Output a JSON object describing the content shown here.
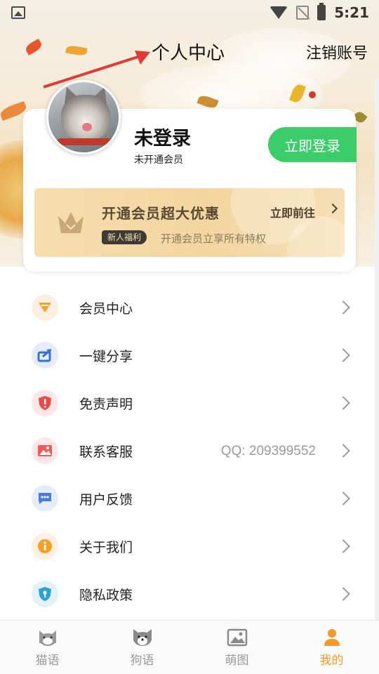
{
  "status_bar": {
    "time": "5:21"
  },
  "header": {
    "title": "个人中心",
    "logout_label": "注销账号"
  },
  "profile": {
    "username": "未登录",
    "member_status": "未开通会员",
    "login_button": "立即登录"
  },
  "vip_banner": {
    "title": "开通会员超大优惠",
    "go_label": "立即前往",
    "tag": "新人福利",
    "subtitle": "开通会员立享所有特权"
  },
  "menu": {
    "items": [
      {
        "label": "会员中心",
        "icon": "diamond-icon",
        "color": "#f4a02d",
        "bg": "#fdf0e0"
      },
      {
        "label": "一键分享",
        "icon": "share-icon",
        "color": "#3a6fd8",
        "bg": "#e4ecfa"
      },
      {
        "label": "免责声明",
        "icon": "shield-alert-icon",
        "color": "#e84a4a",
        "bg": "#fde6e6"
      },
      {
        "label": "联系客服",
        "icon": "image-icon",
        "color": "#ef5a5a",
        "bg": "#fde6e6",
        "extra": "QQ: 209399552"
      },
      {
        "label": "用户反馈",
        "icon": "chat-icon",
        "color": "#4a7be0",
        "bg": "#e5ecfb"
      },
      {
        "label": "关于我们",
        "icon": "info-icon",
        "color": "#f3a12a",
        "bg": "#fdf0de"
      },
      {
        "label": "隐私政策",
        "icon": "shield-lock-icon",
        "color": "#2f9fd8",
        "bg": "#e1f2fb"
      }
    ]
  },
  "bottom_nav": {
    "tabs": [
      {
        "label": "猫语",
        "icon": "cat-icon"
      },
      {
        "label": "狗语",
        "icon": "dog-icon"
      },
      {
        "label": "萌图",
        "icon": "picture-icon"
      },
      {
        "label": "我的",
        "icon": "person-icon",
        "active": true
      }
    ]
  },
  "colors": {
    "accent": "#f39a2b",
    "login_green": "#3dcc6a"
  }
}
